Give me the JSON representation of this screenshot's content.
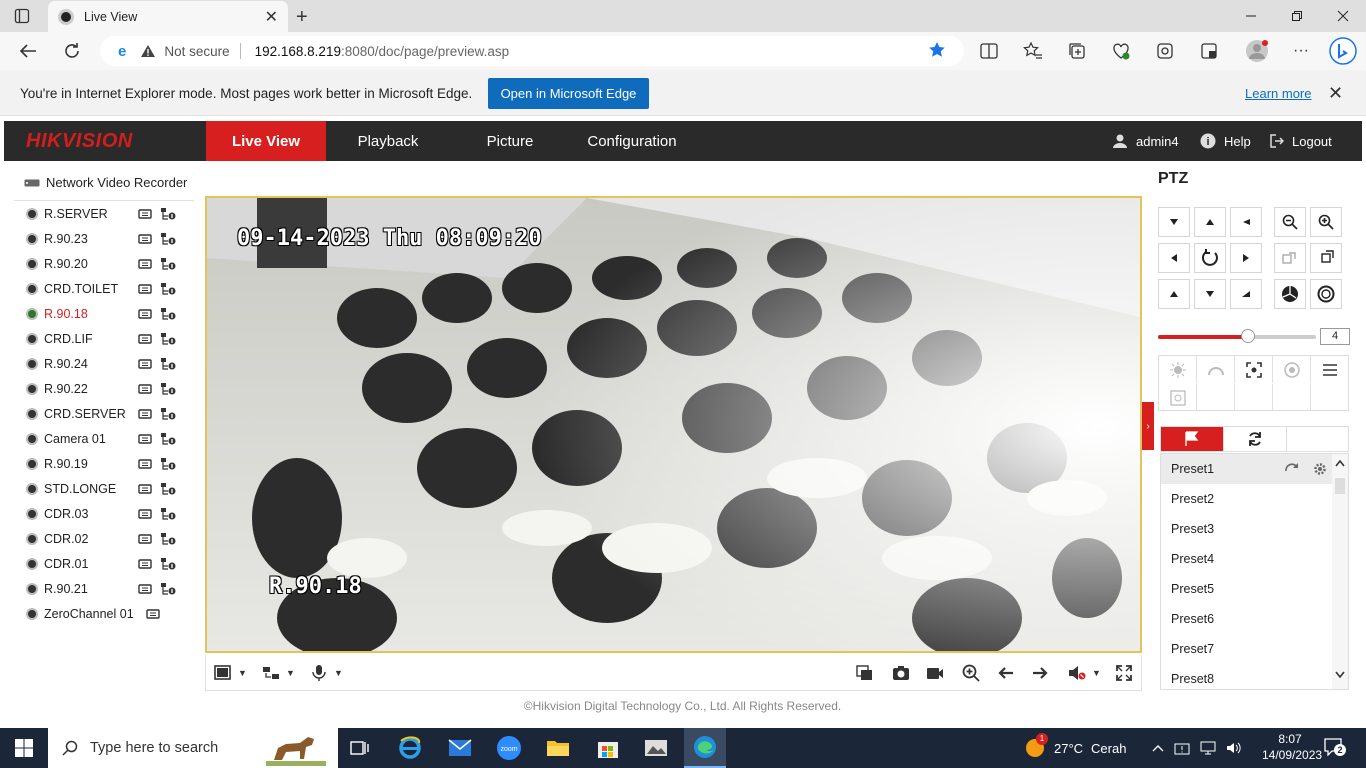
{
  "browser": {
    "tab_title": "Live View",
    "url_security": "Not secure",
    "url_host": "192.168.8.219",
    "url_path": ":8080/doc/page/preview.asp"
  },
  "ie_bar": {
    "message": "You're in Internet Explorer mode. Most pages work better in Microsoft Edge.",
    "open_button": "Open in Microsoft Edge",
    "learn_more": "Learn more"
  },
  "app": {
    "logo": "HIKVISION",
    "nav": [
      "Live View",
      "Playback",
      "Picture",
      "Configuration"
    ],
    "active_nav": "Live View",
    "user": "admin4",
    "help": "Help",
    "logout": "Logout"
  },
  "device_tree": {
    "root": "Network Video Recorder",
    "cameras": [
      "R.SERVER",
      "R.90.23",
      "R.90.20",
      "CRD.TOILET",
      "R.90.18",
      "CRD.LIF",
      "R.90.24",
      "R.90.22",
      "CRD.SERVER",
      "Camera 01",
      "R.90.19",
      "STD.LONGE",
      "CDR.03",
      "CDR.02",
      "CDR.01",
      "R.90.21",
      "ZeroChannel 01"
    ],
    "active_camera": "R.90.18"
  },
  "video": {
    "osd_datetime": "09-14-2023 Thu 08:09:20",
    "osd_channel": "R.90.18"
  },
  "footer": "©Hikvision Digital Technology Co., Ltd. All Rights Reserved.",
  "ptz": {
    "title": "PTZ",
    "speed_fraction": 0.57,
    "speed_value": "4",
    "presets": [
      "Preset1",
      "Preset2",
      "Preset3",
      "Preset4",
      "Preset5",
      "Preset6",
      "Preset7",
      "Preset8"
    ],
    "selected_preset": "Preset1"
  },
  "taskbar": {
    "search_placeholder": "Type here to search",
    "weather_temp": "27°C",
    "weather_text": "Cerah",
    "weather_badge": "1",
    "time": "8:07",
    "date": "14/09/2023",
    "notification_count": "2"
  },
  "colors": {
    "brand_red": "#d71f1f",
    "header_dark": "#2a2a2a",
    "edge_blue": "#0f6cbd",
    "taskbar": "#1b2738"
  }
}
